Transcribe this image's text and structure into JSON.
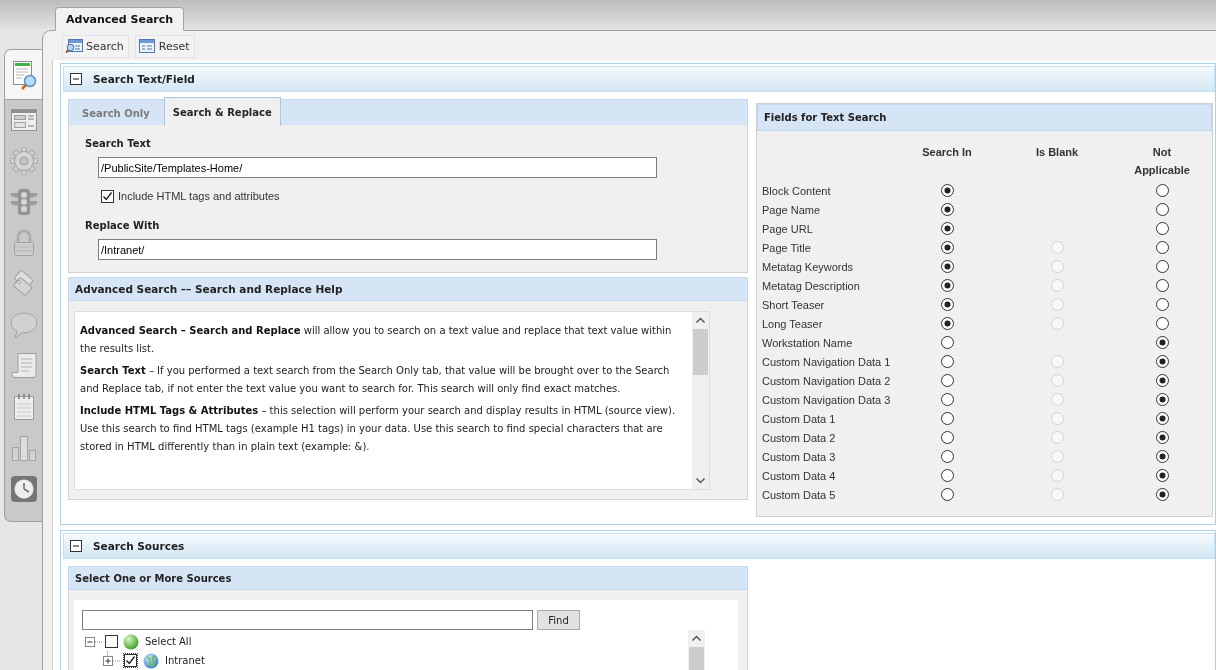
{
  "document_tab": {
    "title": "Advanced Search",
    "selected": true
  },
  "sidebar": {
    "items": [
      {
        "selected": true
      },
      {
        "selected": false
      },
      {
        "selected": false
      },
      {
        "selected": false
      },
      {
        "selected": false
      },
      {
        "selected": false
      },
      {
        "selected": false
      },
      {
        "selected": false
      },
      {
        "selected": false
      },
      {
        "selected": false
      },
      {
        "selected": false
      }
    ]
  },
  "toolbar": {
    "buttons": [
      {
        "label": "Search"
      },
      {
        "label": "Reset"
      }
    ]
  },
  "text_section": {
    "title": "Search Text/Field",
    "expanded": true,
    "tabs": [
      {
        "label": "Search Only",
        "selected": false
      },
      {
        "label": "Search & Replace",
        "selected": true
      }
    ],
    "search_text": {
      "label": "Search Text",
      "value": "/PublicSite/Templates-Home/"
    },
    "include_html": {
      "label": "Include HTML tags and attributes",
      "checked": true
    },
    "replace_with": {
      "label": "Replace With",
      "value": "/Intranet/"
    },
    "help": {
      "title": "Advanced Search –– Search and Replace Help",
      "paragraphs": [
        "**Advanced Search – Search and Replace** will allow you to search on a text value and replace that text value within the results list.",
        "**Search Text** – If you performed a text search from the Search Only tab, that value will be brought over to the Search and Replace tab, if not enter the text value you want to search for. This search will only find exact matches.",
        "**Include HTML Tags & Attributes** – this selection will perform your search and display results in HTML (source view). Use this search to find HTML tags (example H1 tags) in your data. Use this search to find special characters that are stored in HTML differently than in plain text (example: &)."
      ]
    },
    "fields": {
      "title": "Fields for Text Search",
      "columns": [
        "Search In",
        "Is Blank",
        "Not Applicable"
      ],
      "rows": [
        {
          "label": "Block Content",
          "search_in": {
            "selected": true
          },
          "not_applicable": {
            "selected": false
          }
        },
        {
          "label": "Page Name",
          "search_in": {
            "selected": true
          },
          "not_applicable": {
            "selected": false
          }
        },
        {
          "label": "Page URL",
          "search_in": {
            "selected": true
          },
          "not_applicable": {
            "selected": false
          }
        },
        {
          "label": "Page Title",
          "search_in": {
            "selected": true
          },
          "is_blank": {
            "selected": false,
            "disabled": true
          },
          "not_applicable": {
            "selected": false
          }
        },
        {
          "label": "Metatag Keywords",
          "search_in": {
            "selected": true
          },
          "is_blank": {
            "selected": false,
            "disabled": true
          },
          "not_applicable": {
            "selected": false
          }
        },
        {
          "label": "Metatag Description",
          "search_in": {
            "selected": true
          },
          "is_blank": {
            "selected": false,
            "disabled": true
          },
          "not_applicable": {
            "selected": false
          }
        },
        {
          "label": "Short Teaser",
          "search_in": {
            "selected": true
          },
          "is_blank": {
            "selected": false,
            "disabled": true
          },
          "not_applicable": {
            "selected": false
          }
        },
        {
          "label": "Long Teaser",
          "search_in": {
            "selected": true
          },
          "is_blank": {
            "selected": false,
            "disabled": true
          },
          "not_applicable": {
            "selected": false
          }
        },
        {
          "label": "Workstation Name",
          "search_in": {
            "selected": false
          },
          "not_applicable": {
            "selected": true
          }
        },
        {
          "label": "Custom Navigation Data 1",
          "search_in": {
            "selected": false
          },
          "is_blank": {
            "selected": false,
            "disabled": true
          },
          "not_applicable": {
            "selected": true
          }
        },
        {
          "label": "Custom Navigation Data 2",
          "search_in": {
            "selected": false
          },
          "is_blank": {
            "selected": false,
            "disabled": true
          },
          "not_applicable": {
            "selected": true
          }
        },
        {
          "label": "Custom Navigation Data 3",
          "search_in": {
            "selected": false
          },
          "is_blank": {
            "selected": false,
            "disabled": true
          },
          "not_applicable": {
            "selected": true
          }
        },
        {
          "label": "Custom Data 1",
          "search_in": {
            "selected": false
          },
          "is_blank": {
            "selected": false,
            "disabled": true
          },
          "not_applicable": {
            "selected": true
          }
        },
        {
          "label": "Custom Data 2",
          "search_in": {
            "selected": false
          },
          "is_blank": {
            "selected": false,
            "disabled": true
          },
          "not_applicable": {
            "selected": true
          }
        },
        {
          "label": "Custom Data 3",
          "search_in": {
            "selected": false
          },
          "is_blank": {
            "selected": false,
            "disabled": true
          },
          "not_applicable": {
            "selected": true
          }
        },
        {
          "label": "Custom Data 4",
          "search_in": {
            "selected": false
          },
          "is_blank": {
            "selected": false,
            "disabled": true
          },
          "not_applicable": {
            "selected": true
          }
        },
        {
          "label": "Custom Data 5",
          "search_in": {
            "selected": false
          },
          "is_blank": {
            "selected": false,
            "disabled": true
          },
          "not_applicable": {
            "selected": true
          }
        }
      ]
    }
  },
  "sources_section": {
    "title": "Search Sources",
    "expanded": true,
    "panel_title": "Select One or More Sources",
    "find_button": "Find",
    "tree": [
      {
        "label": "Select All",
        "kind": "all",
        "checked": false,
        "focused": false,
        "expanded": true,
        "children": [
          {
            "label": "Intranet",
            "kind": "site",
            "checked": true,
            "focused": true,
            "expanded": false
          }
        ]
      }
    ]
  }
}
